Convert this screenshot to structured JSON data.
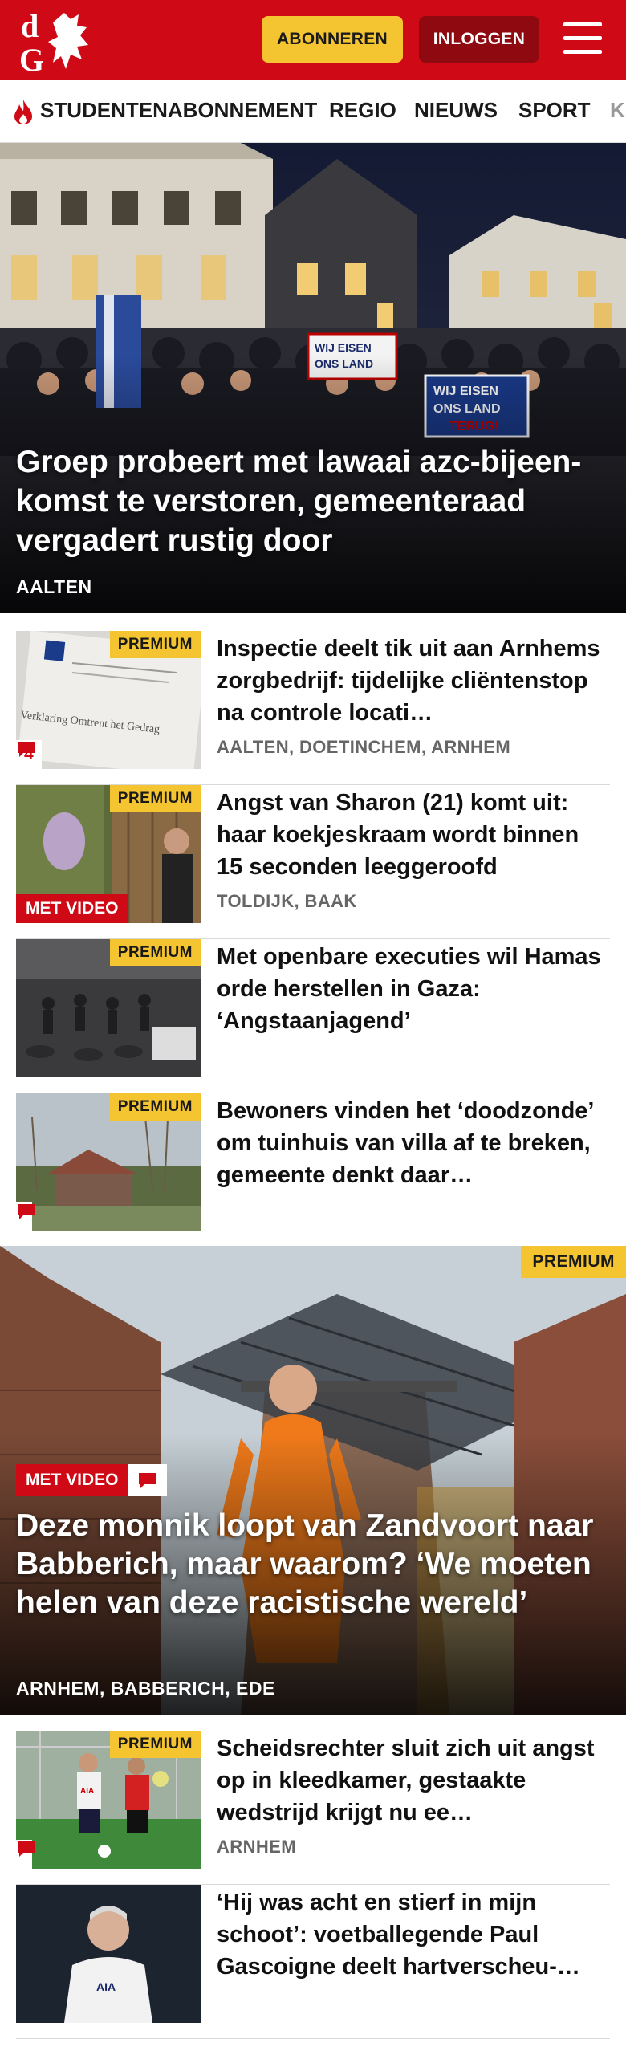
{
  "header": {
    "logo_text": "dG",
    "subscribe_label": "ABONNEREN",
    "login_label": "INLOGGEN",
    "brand_red": "#cf0a16",
    "accent_yellow": "#f5c531"
  },
  "nav": {
    "items": [
      "STUDENTENABONNEMENT",
      "REGIO",
      "NIEUWS",
      "SPORT",
      "K"
    ]
  },
  "hero": {
    "title": "Groep probeert met lawaai azc-bijeen­komst te verstoren, gemeenteraad vergadert rustig door",
    "location": "AALTEN",
    "sign_text_1": "WIJ EISEN ONS LAND TERUG",
    "sign_text_2": "WIJ EISEN ONS LAND TERUG!"
  },
  "articles": [
    {
      "premium": "PREMIUM",
      "title": "Inspectie deelt tik uit aan Arnhems zorgbedrijf: tijdelijke cliëntenstop na controle locati…",
      "location": "AALTEN, DOETINCHEM, ARNHEM",
      "comments": "4",
      "thumb_text": "Verklaring Omtrent het Gedrag"
    },
    {
      "premium": "PREMIUM",
      "title": "Angst van Sharon (21) komt uit: haar koekjeskraam wordt binnen 15 seconden leeggeroofd",
      "location": "TOLDIJK, BAAK",
      "video": "MET VIDEO"
    },
    {
      "premium": "PREMIUM",
      "title": "Met openbare executies wil Hamas orde herstellen in Gaza: ‘Angstaanjagend’",
      "location": ""
    },
    {
      "premium": "PREMIUM",
      "title": "Bewoners vinden het ‘doodzonde’ om tuinhuis van villa af te breken, gemeente denkt daar…",
      "location": ""
    }
  ],
  "feature": {
    "premium": "PREMIUM",
    "video": "MET VIDEO",
    "title": "Deze monnik loopt van Zandvoort naar Babberich, maar waarom? ‘We moeten helen van deze racistische wereld’",
    "location": "ARNHEM, BABBERICH, EDE"
  },
  "articles2": [
    {
      "premium": "PREMIUM",
      "title": "Scheidsrechter sluit zich uit angst op in kleedkamer, gestaakte wedstrijd krijgt nu ee…",
      "location": "ARNHEM",
      "jersey_text": "AIA"
    },
    {
      "title": "‘Hij was acht en stierf in mijn schoot’: voetballegende Paul Gascoigne deelt hartverscheu-…",
      "location": "",
      "jersey_text": "AIA"
    }
  ]
}
